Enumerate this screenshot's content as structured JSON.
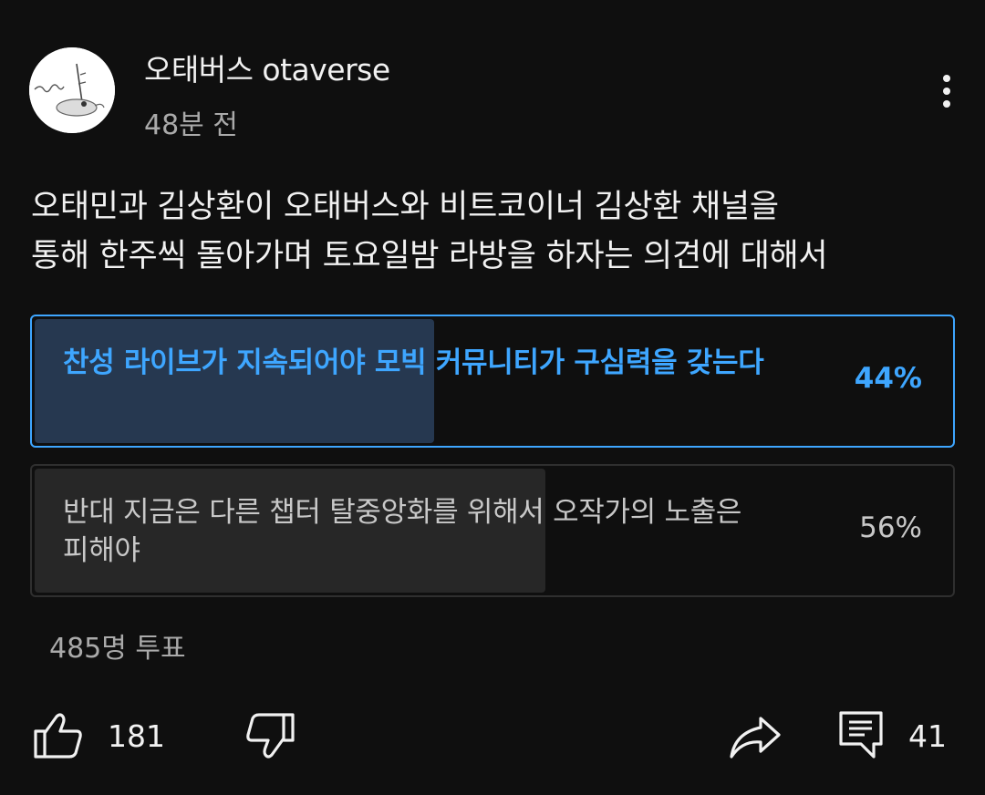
{
  "post": {
    "channel_name": "오태버스 otaverse",
    "timestamp": "48분 전",
    "text": "오태민과 김상환이 오태버스와 비트코이너 김상환 채널을\n통해 한주씩 돌아가며  토요일밤 라방을 하자는 의견에 대해서"
  },
  "poll": {
    "options": [
      {
        "label": "찬성 라이브가 지속되어야 모빅 커뮤니티가 구심력을 갖는다",
        "percent_text": "44%",
        "percent": 44,
        "selected": true
      },
      {
        "label": "반대 지금은 다른 챕터 탈중앙화를 위해서 오작가의 노출은 피해야",
        "percent_text": "56%",
        "percent": 56,
        "selected": false
      }
    ],
    "vote_count": "485명 투표"
  },
  "actions": {
    "like_count": "181",
    "comment_count": "41"
  },
  "icons": {
    "more": "more-vert-icon",
    "like": "thumb-up-icon",
    "dislike": "thumb-down-icon",
    "share": "share-icon",
    "comment": "comment-icon"
  },
  "colors": {
    "background": "#0f0f0f",
    "accent": "#3ea6ff",
    "selected_fill": "#263850",
    "other_fill": "#272727",
    "secondary_text": "#aaaaaa"
  }
}
